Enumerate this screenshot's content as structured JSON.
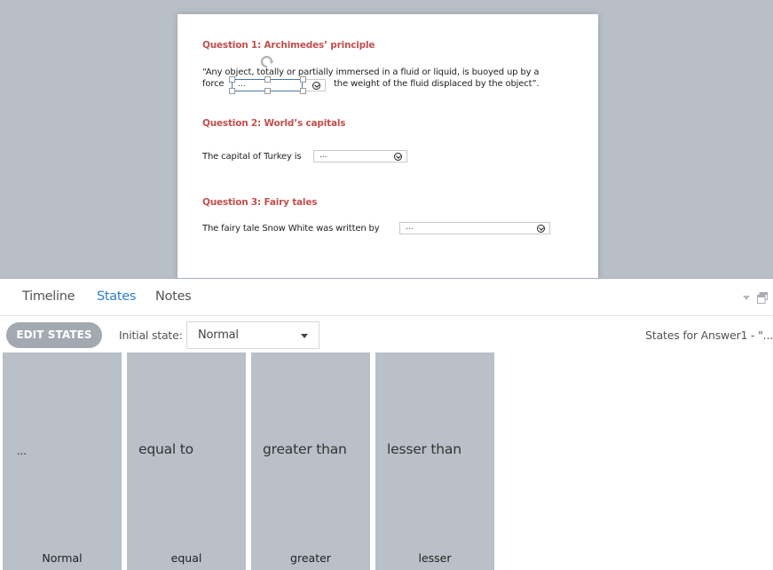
{
  "slide": {
    "questions": [
      {
        "title": "Question 1: Archimedes’ principle",
        "line1": "“Any object, totally or partially immersed in a fluid or liquid, is buoyed up by a",
        "line2_before": "force",
        "line2_after": "the weight of the fluid displaced by the object”.",
        "combo_value": "..."
      },
      {
        "title": "Question 2: World’s capitals",
        "text": "The capital of Turkey is",
        "combo_value": "..."
      },
      {
        "title": "Question 3: Fairy tales",
        "text": "The fairy tale Snow White was written by",
        "combo_value": "..."
      }
    ],
    "combo_icon": "chevron-circle-down-icon",
    "title_color": "#c0504d"
  },
  "panel": {
    "tabs": [
      {
        "label": "Timeline",
        "active": false
      },
      {
        "label": "States",
        "active": true
      },
      {
        "label": "Notes",
        "active": false
      }
    ],
    "accent_color": "#2a7fcf"
  },
  "toolbar": {
    "edit_states_label": "EDIT STATES",
    "initial_state_label": "Initial state:",
    "initial_state_value": "Normal",
    "states_for": "States for Answer1 - \"..."
  },
  "states": [
    {
      "content": "...",
      "name": "Normal"
    },
    {
      "content": "equal to",
      "name": "equal"
    },
    {
      "content": "greater than",
      "name": "greater"
    },
    {
      "content": "lesser than",
      "name": "lesser"
    }
  ]
}
